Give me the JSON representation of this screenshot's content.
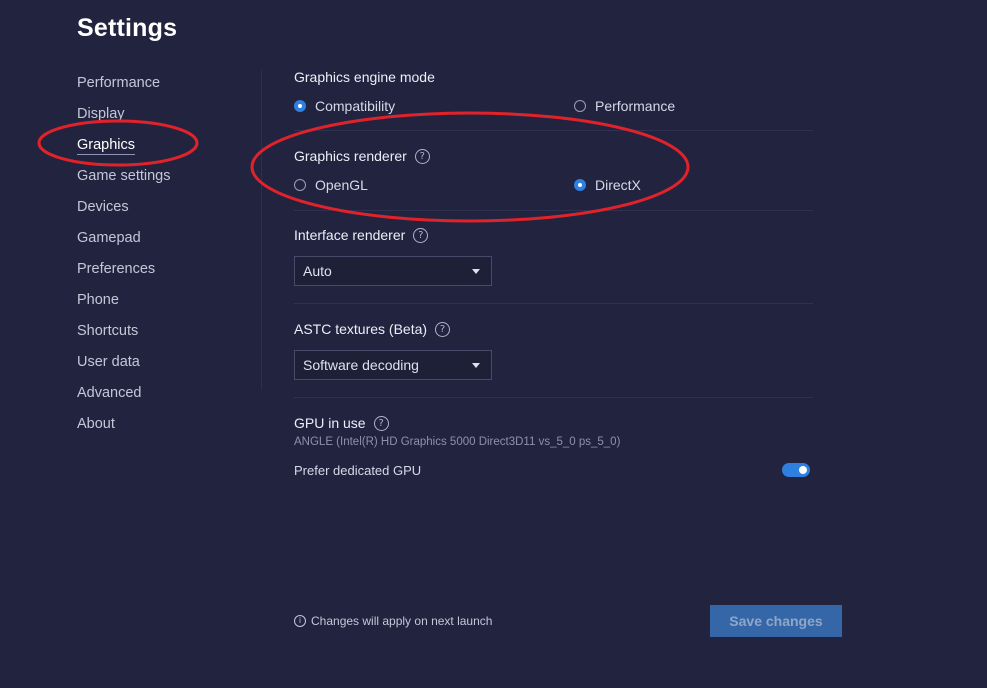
{
  "page_title": "Settings",
  "sidebar": {
    "items": [
      {
        "label": "Performance"
      },
      {
        "label": "Display"
      },
      {
        "label": "Graphics",
        "active": true
      },
      {
        "label": "Game settings"
      },
      {
        "label": "Devices"
      },
      {
        "label": "Gamepad"
      },
      {
        "label": "Preferences"
      },
      {
        "label": "Phone"
      },
      {
        "label": "Shortcuts"
      },
      {
        "label": "User data"
      },
      {
        "label": "Advanced"
      },
      {
        "label": "About"
      }
    ]
  },
  "graphics_engine_mode": {
    "label": "Graphics engine mode",
    "options": [
      {
        "label": "Compatibility",
        "selected": true
      },
      {
        "label": "Performance",
        "selected": false
      }
    ]
  },
  "graphics_renderer": {
    "label": "Graphics renderer",
    "help_icon": "question-circle-icon",
    "options": [
      {
        "label": "OpenGL",
        "selected": false
      },
      {
        "label": "DirectX",
        "selected": true
      }
    ]
  },
  "interface_renderer": {
    "label": "Interface renderer",
    "help_icon": "question-circle-icon",
    "value": "Auto"
  },
  "astc_textures": {
    "label": "ASTC textures (Beta)",
    "help_icon": "question-circle-icon",
    "value": "Software decoding"
  },
  "gpu": {
    "label": "GPU in use",
    "help_icon": "question-circle-icon",
    "info": "ANGLE (Intel(R) HD Graphics 5000 Direct3D11 vs_5_0 ps_5_0)",
    "prefer_dedicated_label": "Prefer dedicated GPU",
    "prefer_dedicated_on": true
  },
  "footer": {
    "note": "Changes will apply on next launch",
    "save_label": "Save changes"
  },
  "colors": {
    "background": "#22243f",
    "accent": "#2f7fe0",
    "annotation": "#e0232b",
    "save_button": "#3567a8"
  }
}
